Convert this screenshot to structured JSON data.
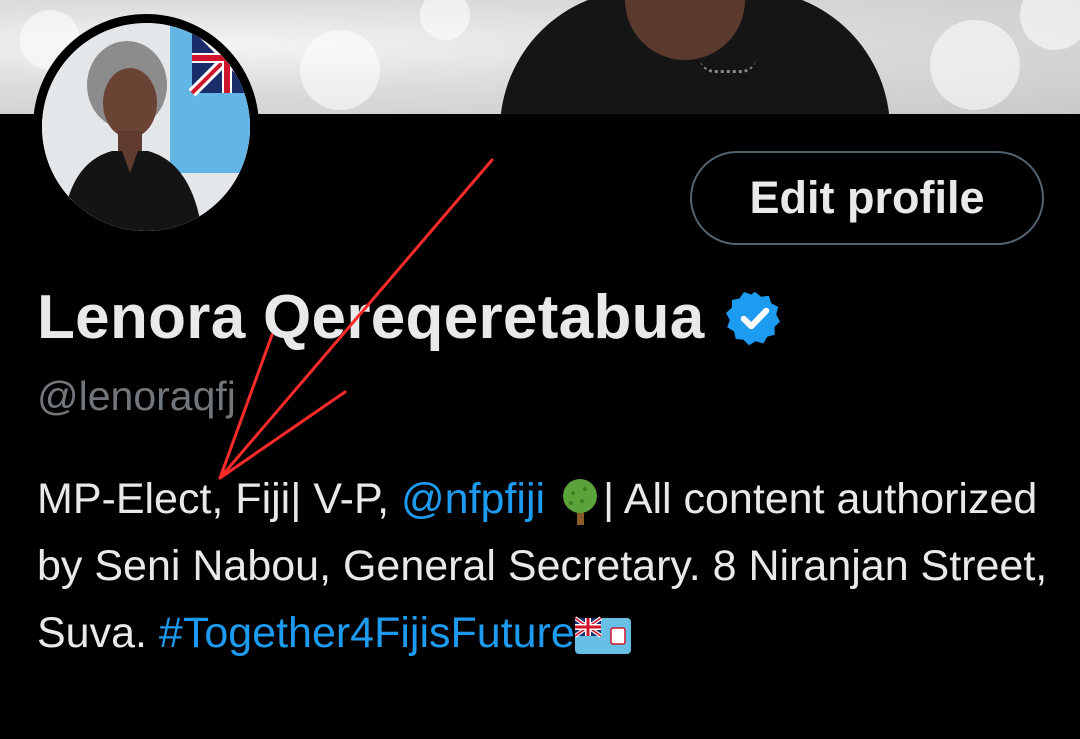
{
  "profile": {
    "name": "Lenora Qereqeretabua",
    "handle": "@lenoraqfj",
    "edit_button_label": "Edit profile"
  },
  "bio": {
    "part1": "MP-Elect, Fiji| V-P, ",
    "mention": "@nfpfiji",
    "part2": "| All content authorized by Seni Nabou, General Secretary. 8 Niranjan Street, Suva.",
    "hashtag": "#Together4FijisFuture"
  },
  "icons": {
    "verified": "verified-badge-icon",
    "tree": "tree-emoji-icon",
    "flag": "fiji-flag-emoji-icon"
  },
  "colors": {
    "background": "#000000",
    "text": "#e7e9ea",
    "secondary": "#71767b",
    "link": "#1d9bf0",
    "annotation": "#ff2a2a"
  }
}
